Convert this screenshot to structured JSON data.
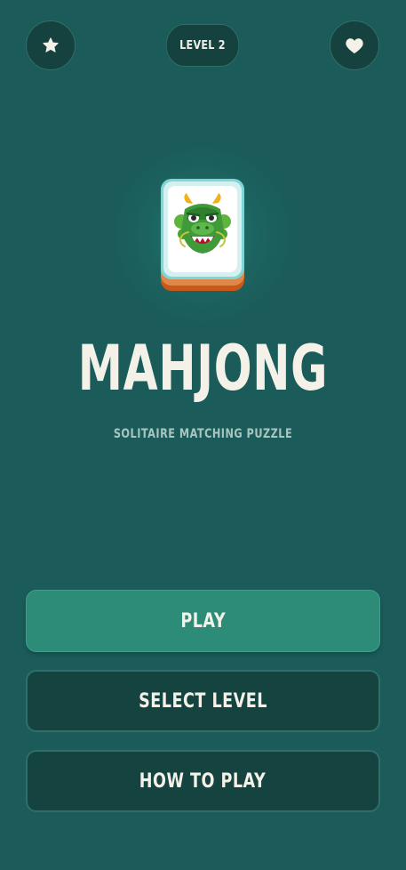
{
  "header": {
    "favorites_icon": "star-icon",
    "level_label": "LEVEL 2",
    "like_icon": "heart-icon"
  },
  "hero": {
    "tile_icon": "dragon-tile-icon",
    "title": "MAHJONG",
    "subtitle": "SOLITAIRE MATCHING PUZZLE"
  },
  "menu": {
    "play_label": "PLAY",
    "select_level_label": "SELECT LEVEL",
    "how_to_play_label": "HOW TO PLAY"
  },
  "colors": {
    "background": "#1b5c5a",
    "dark_button": "#154440",
    "accent_play": "#2d8c78",
    "text_light": "#f4f1e8",
    "text_muted": "#a9c5c0"
  }
}
